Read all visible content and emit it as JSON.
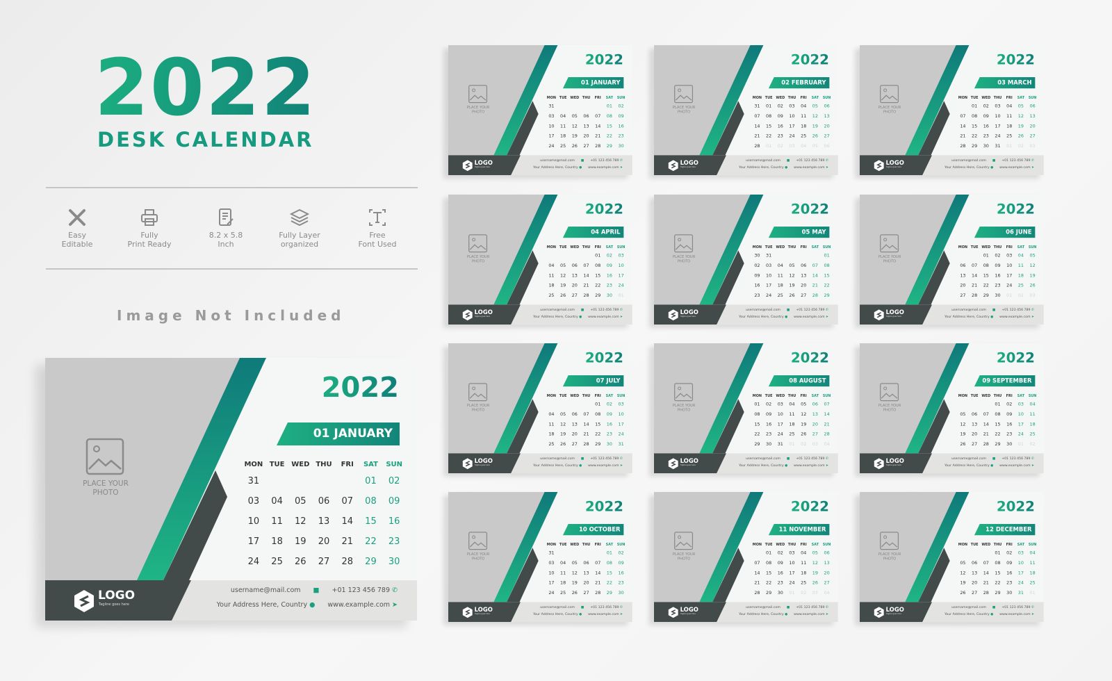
{
  "heading": {
    "year": "2022",
    "subtitle": "DESK CALENDAR"
  },
  "features": [
    {
      "icon": "tools-icon",
      "line1": "Easy",
      "line2": "Editable"
    },
    {
      "icon": "printer-icon",
      "line1": "Fully",
      "line2": "Print Ready"
    },
    {
      "icon": "document-edit-icon",
      "line1": "8.2 x 5.8",
      "line2": "Inch"
    },
    {
      "icon": "layers-icon",
      "line1": "Fully Layer",
      "line2": "organized"
    },
    {
      "icon": "font-icon",
      "line1": "Free",
      "line2": "Font Used"
    }
  ],
  "notice": "Image Not Included",
  "colors": {
    "accent": "#1aa07f",
    "accent_dark": "#0f7c78",
    "dark": "#434a4a",
    "photo_gray": "#c9c9c9",
    "footer": "#e3e3e1"
  },
  "calendar": {
    "year": "2022",
    "weekdays": [
      "MON",
      "TUE",
      "WED",
      "THU",
      "FRI",
      "SAT",
      "SUN"
    ],
    "photo_placeholder": "PLACE YOUR PHOTO",
    "logo": "LOGO",
    "tagline": "Tagline goes here",
    "email": "username@mail.com",
    "phone": "+01 123 456 789",
    "address": "Your Address Here, Country",
    "website": "www.example.com"
  },
  "featured_month": 0,
  "months": [
    {
      "title": "01 JANUARY",
      "weeks": [
        [
          "31",
          "",
          "",
          "",
          "",
          "01",
          "02"
        ],
        [
          "03",
          "04",
          "05",
          "06",
          "07",
          "08",
          "09"
        ],
        [
          "10",
          "11",
          "12",
          "13",
          "14",
          "15",
          "16"
        ],
        [
          "17",
          "18",
          "19",
          "20",
          "21",
          "22",
          "23"
        ],
        [
          "24",
          "25",
          "26",
          "27",
          "28",
          "29",
          "30"
        ]
      ]
    },
    {
      "title": "02 FEBRUARY",
      "weeks": [
        [
          "31",
          "01",
          "02",
          "03",
          "04",
          "05",
          "06"
        ],
        [
          "07",
          "08",
          "09",
          "10",
          "11",
          "12",
          "13"
        ],
        [
          "14",
          "15",
          "16",
          "17",
          "18",
          "19",
          "20"
        ],
        [
          "21",
          "22",
          "23",
          "24",
          "25",
          "26",
          "27"
        ],
        [
          "28",
          "01",
          "02",
          "03",
          "04",
          "05",
          "06"
        ]
      ]
    },
    {
      "title": "03 MARCH",
      "weeks": [
        [
          "",
          "01",
          "02",
          "03",
          "04",
          "05",
          "06"
        ],
        [
          "07",
          "08",
          "09",
          "10",
          "11",
          "12",
          "13"
        ],
        [
          "14",
          "15",
          "16",
          "17",
          "18",
          "19",
          "20"
        ],
        [
          "21",
          "22",
          "23",
          "24",
          "25",
          "26",
          "27"
        ],
        [
          "28",
          "29",
          "30",
          "31",
          "01",
          "02",
          "03"
        ]
      ]
    },
    {
      "title": "04 APRIL",
      "weeks": [
        [
          "",
          "",
          "",
          "",
          "01",
          "02",
          "03"
        ],
        [
          "04",
          "05",
          "06",
          "07",
          "08",
          "09",
          "10"
        ],
        [
          "11",
          "12",
          "13",
          "14",
          "15",
          "16",
          "17"
        ],
        [
          "18",
          "19",
          "20",
          "21",
          "22",
          "23",
          "24"
        ],
        [
          "25",
          "26",
          "27",
          "28",
          "29",
          "30",
          "01"
        ]
      ]
    },
    {
      "title": "05 MAY",
      "weeks": [
        [
          "30",
          "31",
          "",
          "",
          "",
          "",
          "01"
        ],
        [
          "02",
          "03",
          "04",
          "05",
          "06",
          "07",
          "08"
        ],
        [
          "09",
          "10",
          "11",
          "12",
          "13",
          "14",
          "15"
        ],
        [
          "16",
          "17",
          "18",
          "19",
          "20",
          "21",
          "22"
        ],
        [
          "23",
          "24",
          "25",
          "26",
          "27",
          "28",
          "29"
        ]
      ]
    },
    {
      "title": "06 JUNE",
      "weeks": [
        [
          "",
          "",
          "01",
          "02",
          "03",
          "04",
          "05"
        ],
        [
          "06",
          "07",
          "08",
          "09",
          "10",
          "11",
          "12"
        ],
        [
          "13",
          "14",
          "15",
          "16",
          "17",
          "18",
          "19"
        ],
        [
          "20",
          "21",
          "22",
          "23",
          "24",
          "25",
          "26"
        ],
        [
          "27",
          "28",
          "29",
          "30",
          "01",
          "02",
          "03"
        ]
      ]
    },
    {
      "title": "07 JULY",
      "weeks": [
        [
          "",
          "",
          "",
          "",
          "01",
          "02",
          "03"
        ],
        [
          "04",
          "05",
          "06",
          "07",
          "08",
          "09",
          "10"
        ],
        [
          "11",
          "12",
          "13",
          "14",
          "15",
          "16",
          "17"
        ],
        [
          "18",
          "19",
          "20",
          "21",
          "22",
          "23",
          "24"
        ],
        [
          "25",
          "26",
          "27",
          "28",
          "29",
          "30",
          "31"
        ]
      ]
    },
    {
      "title": "08 AUGUST",
      "weeks": [
        [
          "01",
          "02",
          "03",
          "04",
          "05",
          "06",
          "07"
        ],
        [
          "08",
          "09",
          "10",
          "11",
          "12",
          "13",
          "14"
        ],
        [
          "15",
          "16",
          "17",
          "18",
          "19",
          "20",
          "21"
        ],
        [
          "22",
          "23",
          "24",
          "25",
          "26",
          "27",
          "28"
        ],
        [
          "29",
          "30",
          "31",
          "01",
          "02",
          "03",
          "04"
        ]
      ]
    },
    {
      "title": "09 SEPTEMBER",
      "weeks": [
        [
          "",
          "",
          "",
          "01",
          "02",
          "03",
          "04"
        ],
        [
          "05",
          "06",
          "07",
          "08",
          "09",
          "10",
          "11"
        ],
        [
          "12",
          "13",
          "14",
          "15",
          "16",
          "17",
          "18"
        ],
        [
          "19",
          "20",
          "21",
          "22",
          "23",
          "24",
          "25"
        ],
        [
          "26",
          "27",
          "28",
          "29",
          "30",
          "01",
          "02"
        ]
      ]
    },
    {
      "title": "10 OCTOBER",
      "weeks": [
        [
          "31",
          "",
          "",
          "",
          "",
          "01",
          "02"
        ],
        [
          "03",
          "04",
          "05",
          "06",
          "07",
          "08",
          "09"
        ],
        [
          "10",
          "11",
          "12",
          "13",
          "14",
          "15",
          "16"
        ],
        [
          "17",
          "18",
          "19",
          "20",
          "21",
          "22",
          "23"
        ],
        [
          "24",
          "25",
          "26",
          "27",
          "28",
          "29",
          "30"
        ]
      ]
    },
    {
      "title": "11 NOVEMBER",
      "weeks": [
        [
          "",
          "01",
          "02",
          "03",
          "04",
          "05",
          "06"
        ],
        [
          "07",
          "08",
          "09",
          "10",
          "11",
          "12",
          "13"
        ],
        [
          "14",
          "15",
          "16",
          "17",
          "18",
          "19",
          "20"
        ],
        [
          "21",
          "22",
          "23",
          "24",
          "25",
          "26",
          "27"
        ],
        [
          "28",
          "29",
          "30",
          "01",
          "02",
          "03",
          "04"
        ]
      ]
    },
    {
      "title": "12 DECEMBER",
      "weeks": [
        [
          "",
          "",
          "",
          "01",
          "02",
          "03",
          "04"
        ],
        [
          "05",
          "06",
          "07",
          "08",
          "09",
          "10",
          "11"
        ],
        [
          "12",
          "13",
          "14",
          "15",
          "16",
          "17",
          "18"
        ],
        [
          "19",
          "20",
          "21",
          "22",
          "23",
          "24",
          "25"
        ],
        [
          "26",
          "27",
          "28",
          "29",
          "30",
          "31",
          "01"
        ]
      ]
    }
  ]
}
